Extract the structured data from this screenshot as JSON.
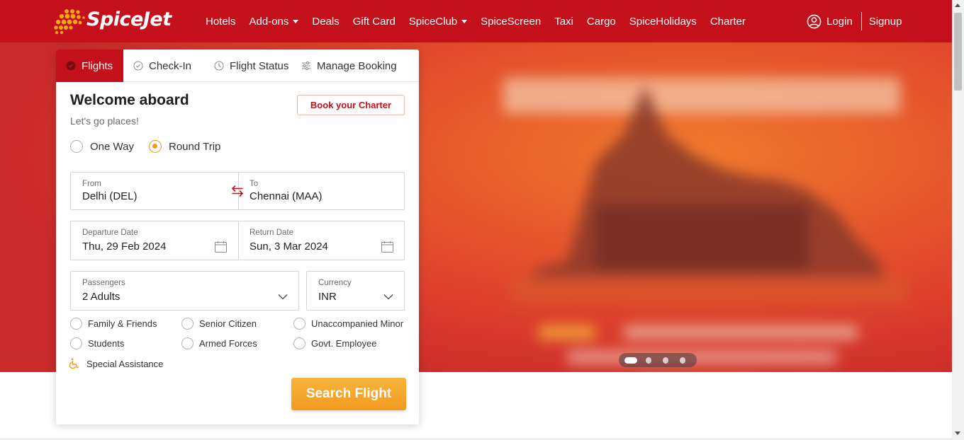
{
  "brand": {
    "name": "SpiceJet",
    "primary_color": "#c3101b",
    "accent_color": "#f29a1f"
  },
  "nav": {
    "items": [
      {
        "label": "Hotels",
        "has_dropdown": false
      },
      {
        "label": "Add-ons",
        "has_dropdown": true
      },
      {
        "label": "Deals",
        "has_dropdown": false
      },
      {
        "label": "Gift Card",
        "has_dropdown": false
      },
      {
        "label": "SpiceClub",
        "has_dropdown": true
      },
      {
        "label": "SpiceScreen",
        "has_dropdown": false
      },
      {
        "label": "Taxi",
        "has_dropdown": false
      },
      {
        "label": "Cargo",
        "has_dropdown": false
      },
      {
        "label": "SpiceHolidays",
        "has_dropdown": false
      },
      {
        "label": "Charter",
        "has_dropdown": false
      }
    ],
    "login_label": "Login",
    "signup_label": "Signup",
    "user_icon": "user-circle-icon"
  },
  "booking": {
    "tabs": [
      {
        "label": "Flights",
        "icon": "flight-icon",
        "active": true
      },
      {
        "label": "Check-In",
        "icon": "check-circle-icon",
        "active": false
      },
      {
        "label": "Flight Status",
        "icon": "clock-icon",
        "active": false
      },
      {
        "label": "Manage Booking",
        "icon": "sliders-icon",
        "active": false
      }
    ],
    "title": "Welcome aboard",
    "subtitle": "Let's go places!",
    "charter_button": "Book your Charter",
    "trip_types": [
      {
        "label": "One Way",
        "selected": false
      },
      {
        "label": "Round Trip",
        "selected": true
      }
    ],
    "from": {
      "label": "From",
      "value": "Delhi (DEL)"
    },
    "to": {
      "label": "To",
      "value": "Chennai (MAA)"
    },
    "departure": {
      "label": "Departure Date",
      "value": "Thu, 29 Feb 2024"
    },
    "return": {
      "label": "Return Date",
      "value": "Sun, 3 Mar 2024"
    },
    "passengers": {
      "label": "Passengers",
      "value": "2 Adults"
    },
    "currency": {
      "label": "Currency",
      "value": "INR"
    },
    "special_fares": [
      {
        "label": "Family & Friends",
        "selected": false
      },
      {
        "label": "Senior Citizen",
        "selected": false
      },
      {
        "label": "Unaccompanied Minor",
        "selected": false
      },
      {
        "label": "Students",
        "selected": false
      },
      {
        "label": "Armed Forces",
        "selected": false
      },
      {
        "label": "Govt. Employee",
        "selected": false
      }
    ],
    "special_assistance": "Special Assistance",
    "search_button": "Search Flight"
  },
  "carousel": {
    "slide_count": 4,
    "active_index": 0
  }
}
